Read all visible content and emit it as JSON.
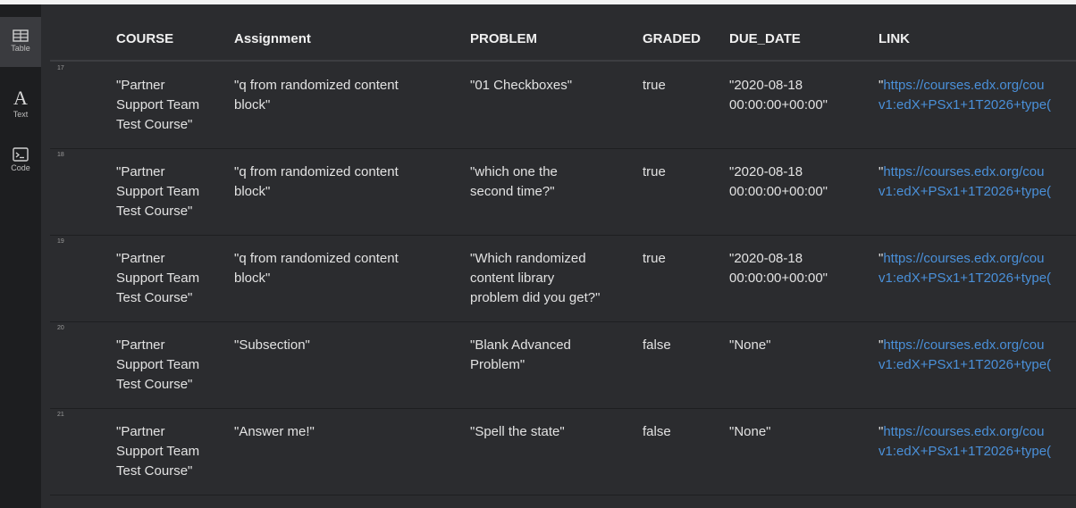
{
  "sidebar": {
    "items": [
      {
        "label": "Table",
        "icon": "table-icon",
        "active": true
      },
      {
        "label": "Text",
        "icon": "text-icon",
        "glyph": "A"
      },
      {
        "label": "Code",
        "icon": "terminal-icon"
      }
    ]
  },
  "table": {
    "columns": [
      "COURSE",
      "Assignment",
      "PROBLEM",
      "GRADED",
      "DUE_DATE",
      "LINK"
    ],
    "rows": [
      {
        "index": "17",
        "course": "\"Partner\nSupport Team\nTest Course\"",
        "assignment": "\"q from randomized content\nblock\"",
        "problem": "\"01 Checkboxes\"",
        "graded": "true",
        "due_date": "\"2020-08-18\n00:00:00+00:00\"",
        "link_line1": "https://courses.edx.org/cou",
        "link_line2": "v1:edX+PSx1+1T2026+type("
      },
      {
        "index": "18",
        "course": "\"Partner\nSupport Team\nTest Course\"",
        "assignment": "\"q from randomized content\nblock\"",
        "problem": "\"which one the\nsecond time?\"",
        "graded": "true",
        "due_date": "\"2020-08-18\n00:00:00+00:00\"",
        "link_line1": "https://courses.edx.org/cou",
        "link_line2": "v1:edX+PSx1+1T2026+type("
      },
      {
        "index": "19",
        "course": "\"Partner\nSupport Team\nTest Course\"",
        "assignment": "\"q from randomized content\nblock\"",
        "problem": "\"Which randomized\ncontent library\nproblem did you get?\"",
        "graded": "true",
        "due_date": "\"2020-08-18\n00:00:00+00:00\"",
        "link_line1": "https://courses.edx.org/cou",
        "link_line2": "v1:edX+PSx1+1T2026+type("
      },
      {
        "index": "20",
        "course": "\"Partner\nSupport Team\nTest Course\"",
        "assignment": "\"Subsection\"",
        "problem": "\"Blank Advanced\nProblem\"",
        "graded": "false",
        "due_date": "\"None\"",
        "link_line1": "https://courses.edx.org/cou",
        "link_line2": "v1:edX+PSx1+1T2026+type("
      },
      {
        "index": "21",
        "course": "\"Partner\nSupport Team\nTest Course\"",
        "assignment": "\"Answer me!\"",
        "problem": "\"Spell the state\"",
        "graded": "false",
        "due_date": "\"None\"",
        "link_line1": "https://courses.edx.org/cou",
        "link_line2": "v1:edX+PSx1+1T2026+type("
      }
    ]
  },
  "colors": {
    "background": "#2b2c2f",
    "sidebar": "#1d1e20",
    "link": "#4a90d9",
    "text": "#e2e2e2"
  }
}
